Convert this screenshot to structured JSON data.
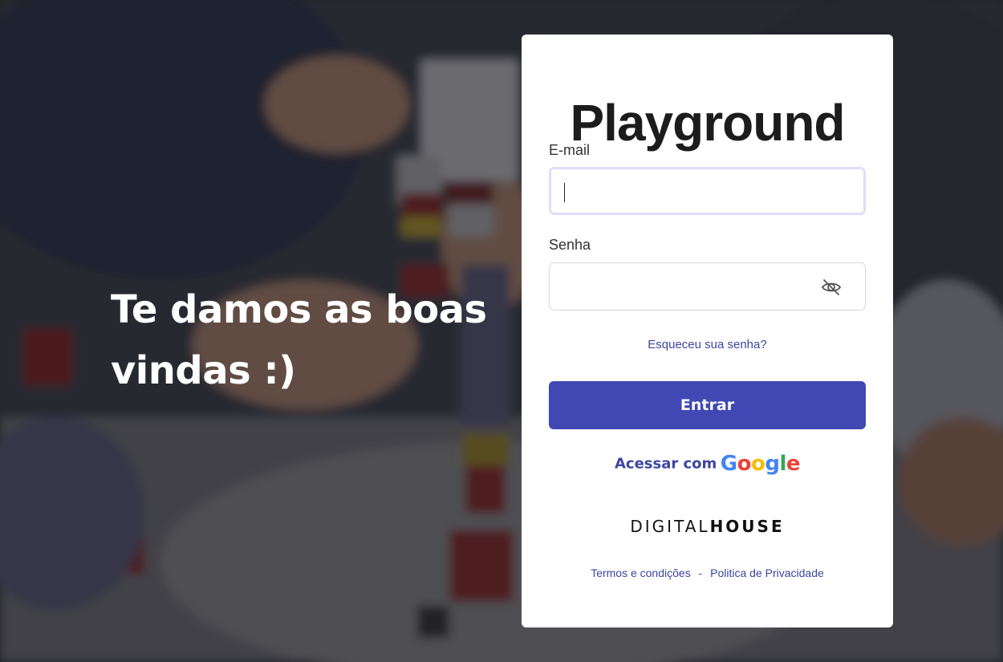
{
  "hero": {
    "welcome_text": "Te damos as boas vindas :)"
  },
  "login": {
    "title": "Playground",
    "email_label": "E-mail",
    "email_value": "",
    "password_label": "Senha",
    "password_value": "",
    "forgot_password": "Esqueceu sua senha?",
    "submit_label": "Entrar",
    "google_prefix": "Acessar com",
    "google_word": [
      "G",
      "o",
      "o",
      "g",
      "l",
      "e"
    ],
    "brand_light": "DIGITAL",
    "brand_bold": "HOUSE",
    "terms_link": "Termos e condições",
    "separator": "-",
    "privacy_link": "Politica de Privacidade"
  },
  "icons": {
    "password_toggle": "eye-slash-icon"
  },
  "colors": {
    "primary": "#4148b4",
    "link": "#3c46a0",
    "focus_border": "#e0defa",
    "google_blue": "#4285F4",
    "google_red": "#EA4335",
    "google_yellow": "#FBBC05",
    "google_green": "#34A853"
  }
}
